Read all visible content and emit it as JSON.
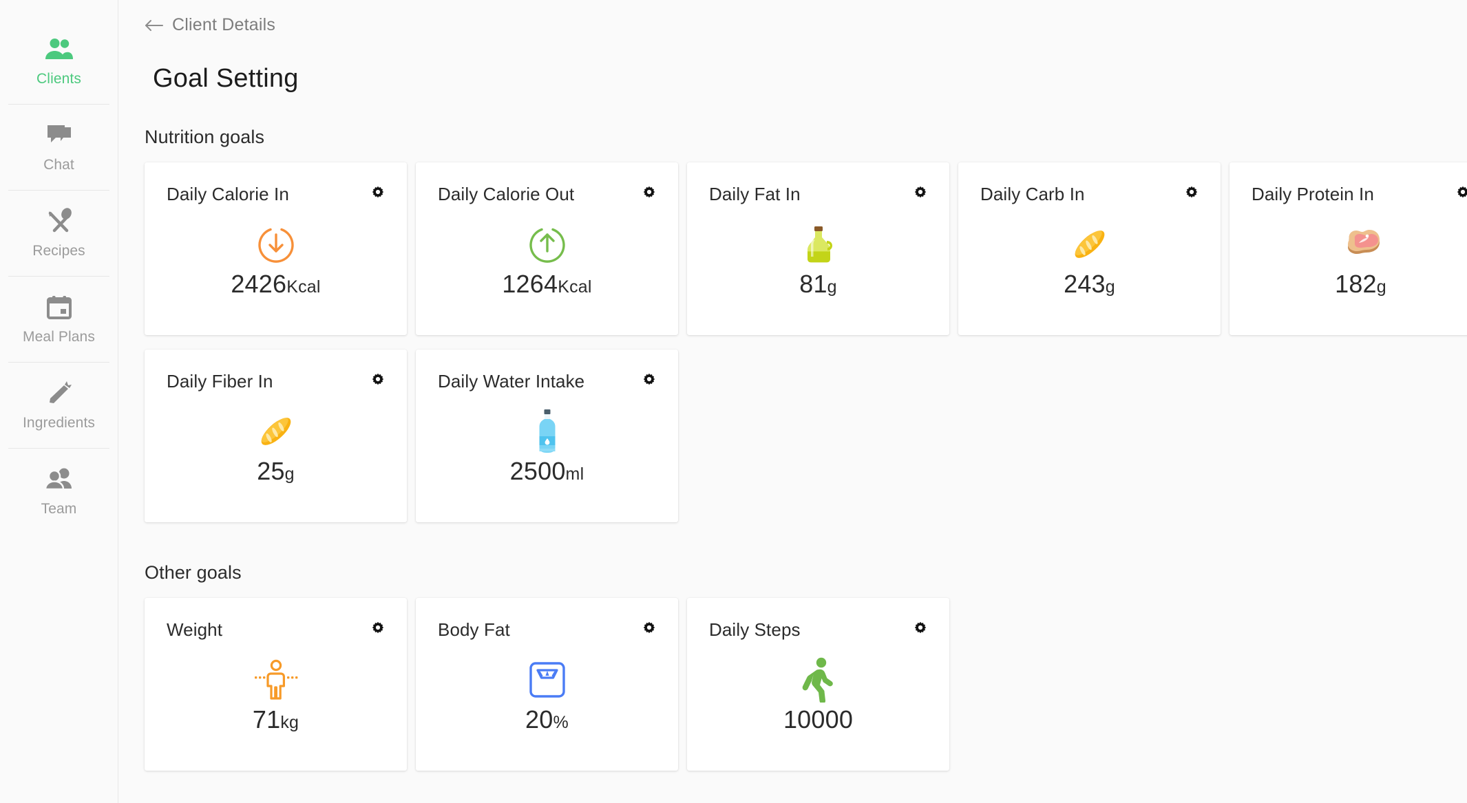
{
  "sidebar": {
    "items": [
      {
        "label": "Clients",
        "icon": "people-icon",
        "active": true
      },
      {
        "label": "Chat",
        "icon": "chat-bubble-icon",
        "active": false
      },
      {
        "label": "Recipes",
        "icon": "fork-spoon-icon",
        "active": false
      },
      {
        "label": "Meal Plans",
        "icon": "calendar-icon",
        "active": false
      },
      {
        "label": "Ingredients",
        "icon": "carrot-icon",
        "active": false
      },
      {
        "label": "Team",
        "icon": "team-icon",
        "active": false
      }
    ],
    "active_color": "#4cc97e",
    "inactive_color": "#9b9b9b"
  },
  "breadcrumb": {
    "back_icon": "arrow-left-icon",
    "label": "Client Details"
  },
  "page": {
    "title": "Goal Setting"
  },
  "sections": {
    "nutrition": {
      "title": "Nutrition goals",
      "cards": [
        {
          "title": "Daily Calorie In",
          "value": "2426",
          "unit": "Kcal",
          "icon": "arrow-down-circle-icon",
          "icon_color": "#f79039",
          "gear": "gear-icon"
        },
        {
          "title": "Daily Calorie Out",
          "value": "1264",
          "unit": "Kcal",
          "icon": "arrow-up-circle-icon",
          "icon_color": "#76bd4c",
          "gear": "gear-icon"
        },
        {
          "title": "Daily Fat In",
          "value": "81",
          "unit": "g",
          "icon": "oil-bottle-icon",
          "icon_color": "#b6c417",
          "gear": "gear-icon"
        },
        {
          "title": "Daily Carb In",
          "value": "243",
          "unit": "g",
          "icon": "bread-baguette-icon",
          "icon_color": "#f9b212",
          "gear": "gear-icon"
        },
        {
          "title": "Daily Protein In",
          "value": "182",
          "unit": "g",
          "icon": "cut-of-meat-icon",
          "icon_color": "#f79e9e",
          "gear": "gear-icon"
        }
      ],
      "cards_row2": [
        {
          "title": "Daily Fiber In",
          "value": "25",
          "unit": "g",
          "icon": "bread-baguette-icon",
          "icon_color": "#f9b212",
          "gear": "gear-icon"
        },
        {
          "title": "Daily Water Intake",
          "value": "2500",
          "unit": "ml",
          "icon": "water-bottle-icon",
          "icon_color": "#79d4f5",
          "gear": "gear-icon"
        }
      ]
    },
    "other": {
      "title": "Other goals",
      "cards": [
        {
          "title": "Weight",
          "value": "71",
          "unit": "kg",
          "icon": "body-measure-icon",
          "icon_color": "#f79a28",
          "gear": "gear-icon"
        },
        {
          "title": "Body Fat",
          "value": "20",
          "unit": "%",
          "icon": "bathroom-scale-icon",
          "icon_color": "#4a7cf5",
          "gear": "gear-icon"
        },
        {
          "title": "Daily Steps",
          "value": "10000",
          "unit": "",
          "icon": "walking-person-icon",
          "icon_color": "#6fb84a",
          "gear": "gear-icon"
        }
      ]
    }
  }
}
